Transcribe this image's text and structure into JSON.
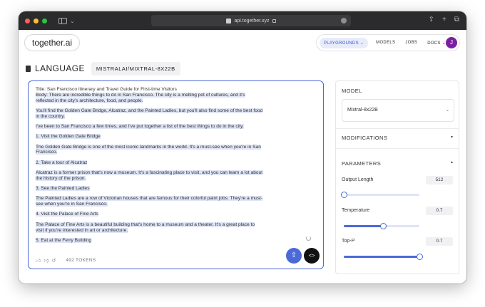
{
  "browser": {
    "url": "api.together.xyz"
  },
  "header": {
    "logo": "together.ai",
    "nav": [
      {
        "label": "PLAYGROUNDS ⌄",
        "active": true
      },
      {
        "label": "MODELS",
        "active": false
      },
      {
        "label": "JOBS",
        "active": false
      },
      {
        "label": "DOCS ⌄",
        "active": false
      }
    ],
    "avatar_initial": "J"
  },
  "page": {
    "title": "LANGUAGE",
    "model_badge": "MISTRALAI/MIXTRAL-8X22B"
  },
  "prompt": {
    "paragraphs": [
      "Title: San Francisco Itinerary and Travel Guide for First-time Visitors\nBody: There are incredible things to do in San Francisco. The city is a melting pot of cultures, and it's reflected in the city's architecture, food, and people.",
      "You'll find the Golden Gate Bridge, Alcatraz, and the Painted Ladies, but you'll also find some of the best food in the country.",
      "I've been to San Francisco a few times, and I've put together a list of the best things to do in the city.",
      "1. Visit the Golden Gate Bridge",
      "The Golden Gate Bridge is one of the most iconic landmarks in the world. It's a must-see when you're in San Francisco.",
      "2. Take a tour of Alcatraz",
      "Alcatraz is a former prison that's now a museum. It's a fascinating place to visit, and you can learn a lot about the history of the prison.",
      "3. See the Painted Ladies",
      "The Painted Ladies are a row of Victorian houses that are famous for their colorful paint jobs. They're a must-see when you're in San Francisco.",
      "4. Visit the Palace of Fine Arts",
      "The Palace of Fine Arts is a beautiful building that's home to a museum and a theater. It's a great place to visit if you're interested in art or architecture.",
      "5. Eat at the Ferry Building"
    ],
    "token_count": "492 TOKENS"
  },
  "settings": {
    "model_label": "MODEL",
    "model_value": "Mixtral-8x22B",
    "modifications_label": "MODIFICATIONS",
    "parameters_label": "PARAMETERS",
    "params": [
      {
        "label": "Output Length",
        "value": "512",
        "fraction": 0.0
      },
      {
        "label": "Temperature",
        "value": "0.7",
        "fraction": 0.52
      },
      {
        "label": "Top-P",
        "value": "0.7",
        "fraction": 1.0
      }
    ]
  },
  "colors": {
    "accent": "#4b6ad8",
    "avatar": "#7b1fa2",
    "highlight": "#dfe5f5"
  }
}
